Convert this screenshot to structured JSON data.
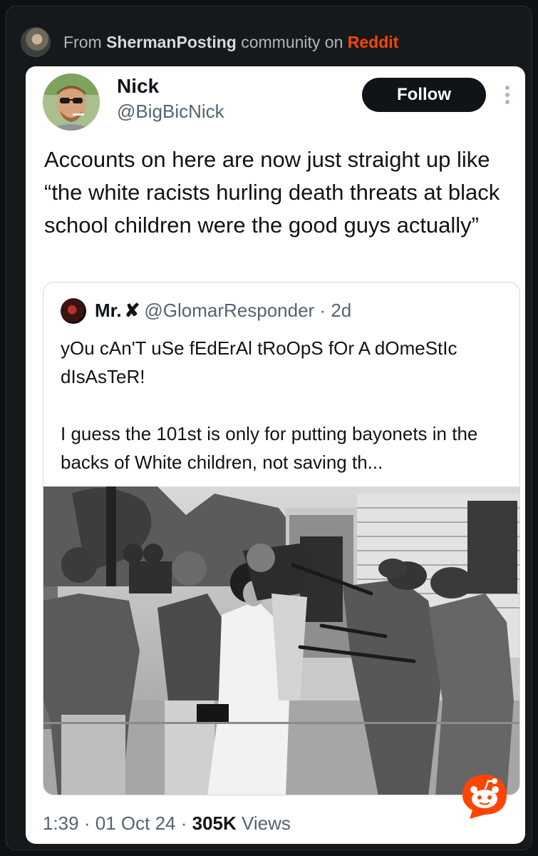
{
  "source": {
    "prefix": "From",
    "community": "ShermanPosting",
    "middle": "community on",
    "platform": "Reddit"
  },
  "tweet": {
    "author_name": "Nick",
    "author_handle": "@BigBicNick",
    "follow_label": "Follow",
    "text": "Accounts on here are now just straight up like “the white racists hurling death threats at black school children were the good guys actually”",
    "time": "1:39",
    "date": "01 Oct 24",
    "views_count": "305K",
    "views_label": "Views"
  },
  "quote": {
    "name": "Mr.",
    "badge": "✘",
    "handle": "@GlomarResponder",
    "age": "· 2d",
    "text": "yOu cAn'T uSe fEdErAl tRoOpS fOr A dOmeStIc dIsAsTeR!\n\nI guess the 101st is only for putting bayonets in the backs of White children, not saving th..."
  },
  "icons": {
    "more": "more-vertical-icon",
    "reddit": "reddit-snoo-icon"
  },
  "colors": {
    "reddit_orange": "#ff4500",
    "follow_button": "#0f1419",
    "secondary_text": "#536471"
  }
}
